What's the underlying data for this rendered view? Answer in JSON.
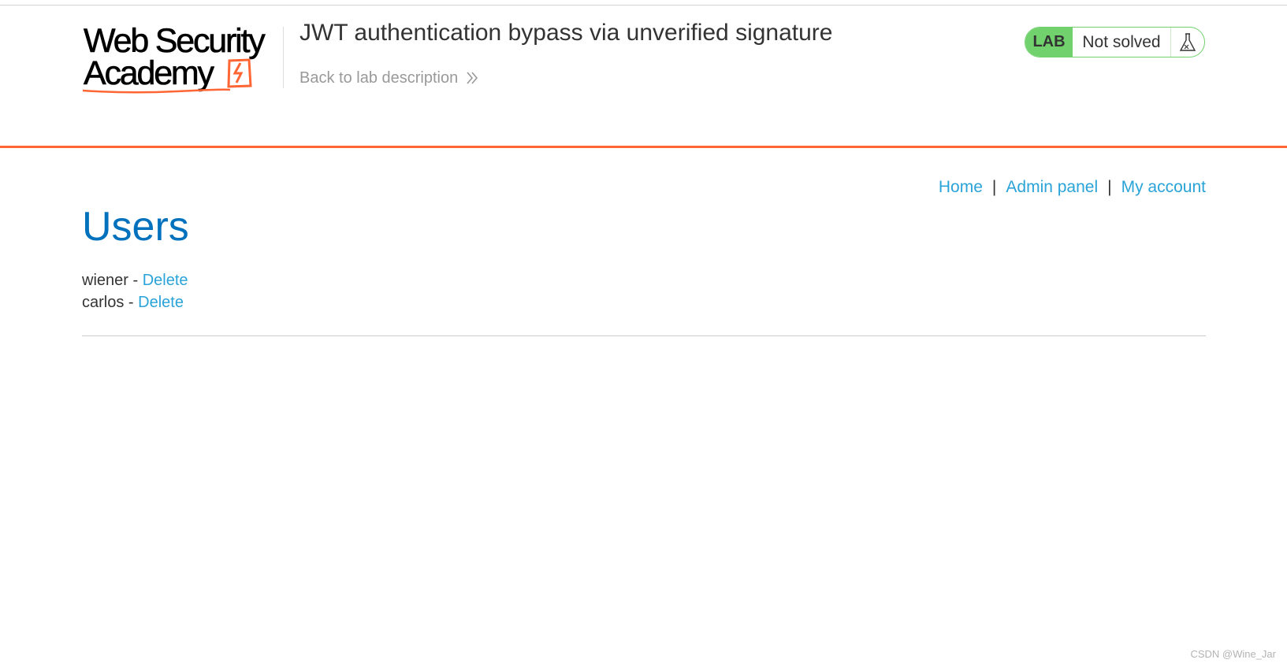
{
  "brand": {
    "logo_line1": "Web Security",
    "logo_line2": "Academy",
    "accent_color": "#ff6633"
  },
  "header": {
    "lab_title": "JWT authentication bypass via unverified signature",
    "back_link": "Back to lab description",
    "lab_badge": "LAB",
    "lab_status": "Not solved",
    "lab_status_icon": "flask-icon",
    "badge_color": "#70d16d"
  },
  "nav": {
    "home": "Home",
    "admin_panel": "Admin panel",
    "my_account": "My account",
    "separator": "|"
  },
  "main": {
    "title": "Users",
    "users": [
      {
        "name": "wiener",
        "dash": "-",
        "action": "Delete"
      },
      {
        "name": "carlos",
        "dash": "-",
        "action": "Delete"
      }
    ]
  },
  "watermark": "CSDN @Wine_Jar",
  "colors": {
    "link": "#29a3d8",
    "title_blue": "#0071bc"
  }
}
